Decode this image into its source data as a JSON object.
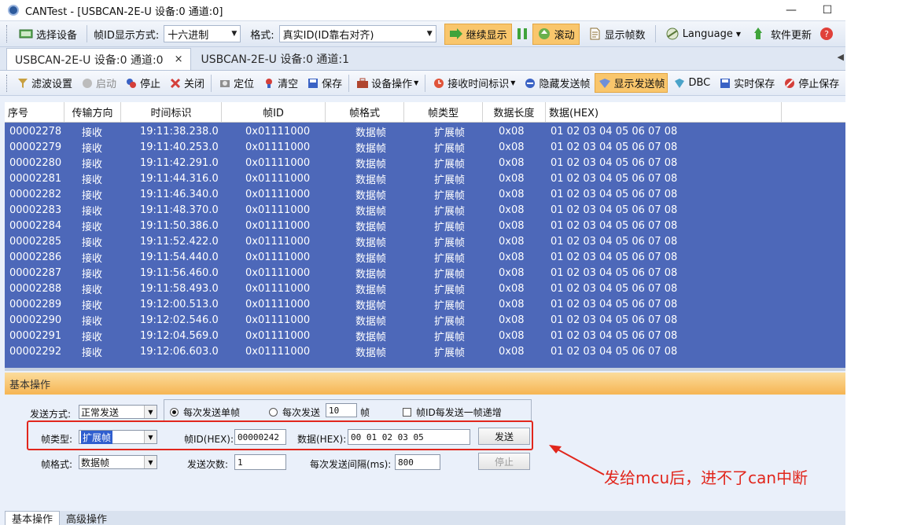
{
  "window": {
    "title": "CANTest - [USBCAN-2E-U 设备:0 通道:0]",
    "minimize": "—",
    "maximize": "☐"
  },
  "toolbar1": {
    "select_device": "选择设备",
    "id_display_label": "帧ID显示方式:",
    "id_display_value": "十六进制",
    "format_label": "格式:",
    "format_value": "真实ID(ID靠右对齐)",
    "continue_display": "继续显示",
    "scroll": "滚动",
    "show_frame_count": "显示帧数",
    "language": "Language",
    "software_update": "软件更新"
  },
  "tabs": [
    {
      "label": "USBCAN-2E-U 设备:0 通道:0",
      "close": "×"
    },
    {
      "label": "USBCAN-2E-U 设备:0 通道:1"
    }
  ],
  "tab_scroll": "◀",
  "toolbar2": {
    "filter": "滤波设置",
    "start": "启动",
    "stop": "停止",
    "close": "关闭",
    "locate": "定位",
    "clear": "清空",
    "save": "保存",
    "device_ops": "设备操作",
    "recv_time": "接收时间标识",
    "hide_sent": "隐藏发送帧",
    "show_sent": "显示发送帧",
    "dbc": "DBC",
    "realtime_save": "实时保存",
    "stop_save": "停止保存"
  },
  "table": {
    "headers": [
      "序号",
      "传输方向",
      "时间标识",
      "帧ID",
      "帧格式",
      "帧类型",
      "数据长度",
      "数据(HEX)"
    ],
    "rows": [
      [
        "00002278",
        "接收",
        "19:11:38.238.0",
        "0x01111000",
        "数据帧",
        "扩展帧",
        "0x08",
        "01 02 03 04 05 06 07 08"
      ],
      [
        "00002279",
        "接收",
        "19:11:40.253.0",
        "0x01111000",
        "数据帧",
        "扩展帧",
        "0x08",
        "01 02 03 04 05 06 07 08"
      ],
      [
        "00002280",
        "接收",
        "19:11:42.291.0",
        "0x01111000",
        "数据帧",
        "扩展帧",
        "0x08",
        "01 02 03 04 05 06 07 08"
      ],
      [
        "00002281",
        "接收",
        "19:11:44.316.0",
        "0x01111000",
        "数据帧",
        "扩展帧",
        "0x08",
        "01 02 03 04 05 06 07 08"
      ],
      [
        "00002282",
        "接收",
        "19:11:46.340.0",
        "0x01111000",
        "数据帧",
        "扩展帧",
        "0x08",
        "01 02 03 04 05 06 07 08"
      ],
      [
        "00002283",
        "接收",
        "19:11:48.370.0",
        "0x01111000",
        "数据帧",
        "扩展帧",
        "0x08",
        "01 02 03 04 05 06 07 08"
      ],
      [
        "00002284",
        "接收",
        "19:11:50.386.0",
        "0x01111000",
        "数据帧",
        "扩展帧",
        "0x08",
        "01 02 03 04 05 06 07 08"
      ],
      [
        "00002285",
        "接收",
        "19:11:52.422.0",
        "0x01111000",
        "数据帧",
        "扩展帧",
        "0x08",
        "01 02 03 04 05 06 07 08"
      ],
      [
        "00002286",
        "接收",
        "19:11:54.440.0",
        "0x01111000",
        "数据帧",
        "扩展帧",
        "0x08",
        "01 02 03 04 05 06 07 08"
      ],
      [
        "00002287",
        "接收",
        "19:11:56.460.0",
        "0x01111000",
        "数据帧",
        "扩展帧",
        "0x08",
        "01 02 03 04 05 06 07 08"
      ],
      [
        "00002288",
        "接收",
        "19:11:58.493.0",
        "0x01111000",
        "数据帧",
        "扩展帧",
        "0x08",
        "01 02 03 04 05 06 07 08"
      ],
      [
        "00002289",
        "接收",
        "19:12:00.513.0",
        "0x01111000",
        "数据帧",
        "扩展帧",
        "0x08",
        "01 02 03 04 05 06 07 08"
      ],
      [
        "00002290",
        "接收",
        "19:12:02.546.0",
        "0x01111000",
        "数据帧",
        "扩展帧",
        "0x08",
        "01 02 03 04 05 06 07 08"
      ],
      [
        "00002291",
        "接收",
        "19:12:04.569.0",
        "0x01111000",
        "数据帧",
        "扩展帧",
        "0x08",
        "01 02 03 04 05 06 07 08"
      ],
      [
        "00002292",
        "接收",
        "19:12:06.603.0",
        "0x01111000",
        "数据帧",
        "扩展帧",
        "0x08",
        "01 02 03 04 05 06 07 08"
      ]
    ]
  },
  "panel": {
    "title": "基本操作",
    "send_mode_label": "发送方式:",
    "send_mode_value": "正常发送",
    "radio_single": "每次发送单帧",
    "radio_multi": "每次发送",
    "multi_count": "10",
    "multi_unit": "帧",
    "checkbox_increment": "帧ID每发送一帧递增",
    "frame_type_label": "帧类型:",
    "frame_type_value": "扩展帧",
    "frame_id_label": "帧ID(HEX):",
    "frame_id_value": "00000242",
    "data_label": "数据(HEX):",
    "data_value": "00 01 02 03 05",
    "send_button": "发送",
    "frame_format_label": "帧格式:",
    "frame_format_value": "数据帧",
    "send_count_label": "发送次数:",
    "send_count_value": "1",
    "interval_label": "每次发送间隔(ms):",
    "interval_value": "800",
    "stop_button": "停止"
  },
  "bottom_tabs": [
    "基本操作",
    "高级操作"
  ],
  "annotation": {
    "text": "发给mcu后，进不了can中断",
    "color": "#e1261c"
  },
  "colors": {
    "grid_bg": "#4d68b9",
    "highlight": "#f9c66c",
    "panel_header": "#f6b553"
  },
  "icons": {
    "app": "can-app-icon",
    "select_device": "device-icon",
    "continue_display": "play-arrow-icon",
    "pause": "pause-icon",
    "scroll": "scroll-icon",
    "frame_count": "document-icon",
    "language": "globe-icon",
    "update": "update-arrow-icon",
    "help": "help-icon"
  }
}
